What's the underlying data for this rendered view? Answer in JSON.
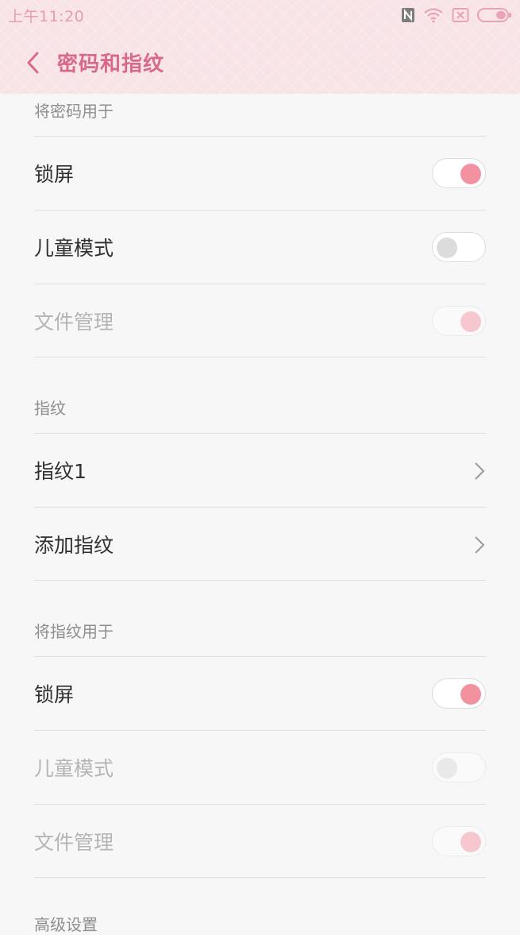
{
  "status_bar": {
    "time": "上午11:20"
  },
  "header": {
    "title": "密码和指纹"
  },
  "sections": [
    {
      "header": "将密码用于",
      "items": [
        {
          "label": "锁屏",
          "toggle": "on",
          "enabled": true
        },
        {
          "label": "儿童模式",
          "toggle": "off",
          "enabled": true
        },
        {
          "label": "文件管理",
          "toggle": "on",
          "enabled": false
        }
      ]
    },
    {
      "header": "指纹",
      "items": [
        {
          "label": "指纹1",
          "type": "nav"
        },
        {
          "label": "添加指纹",
          "type": "nav"
        }
      ]
    },
    {
      "header": "将指纹用于",
      "items": [
        {
          "label": "锁屏",
          "toggle": "on",
          "enabled": true
        },
        {
          "label": "儿童模式",
          "toggle": "off",
          "enabled": false
        },
        {
          "label": "文件管理",
          "toggle": "on",
          "enabled": false
        }
      ]
    },
    {
      "header": "高级设置"
    }
  ],
  "colors": {
    "accent": "#d76a8a",
    "toggle_on": "#f2919f",
    "header_bg": "#f8e3e7"
  },
  "icons": [
    "nfc-icon",
    "wifi-icon",
    "sim-x-icon",
    "battery-icon",
    "back-arrow-icon",
    "chevron-right-icon"
  ]
}
